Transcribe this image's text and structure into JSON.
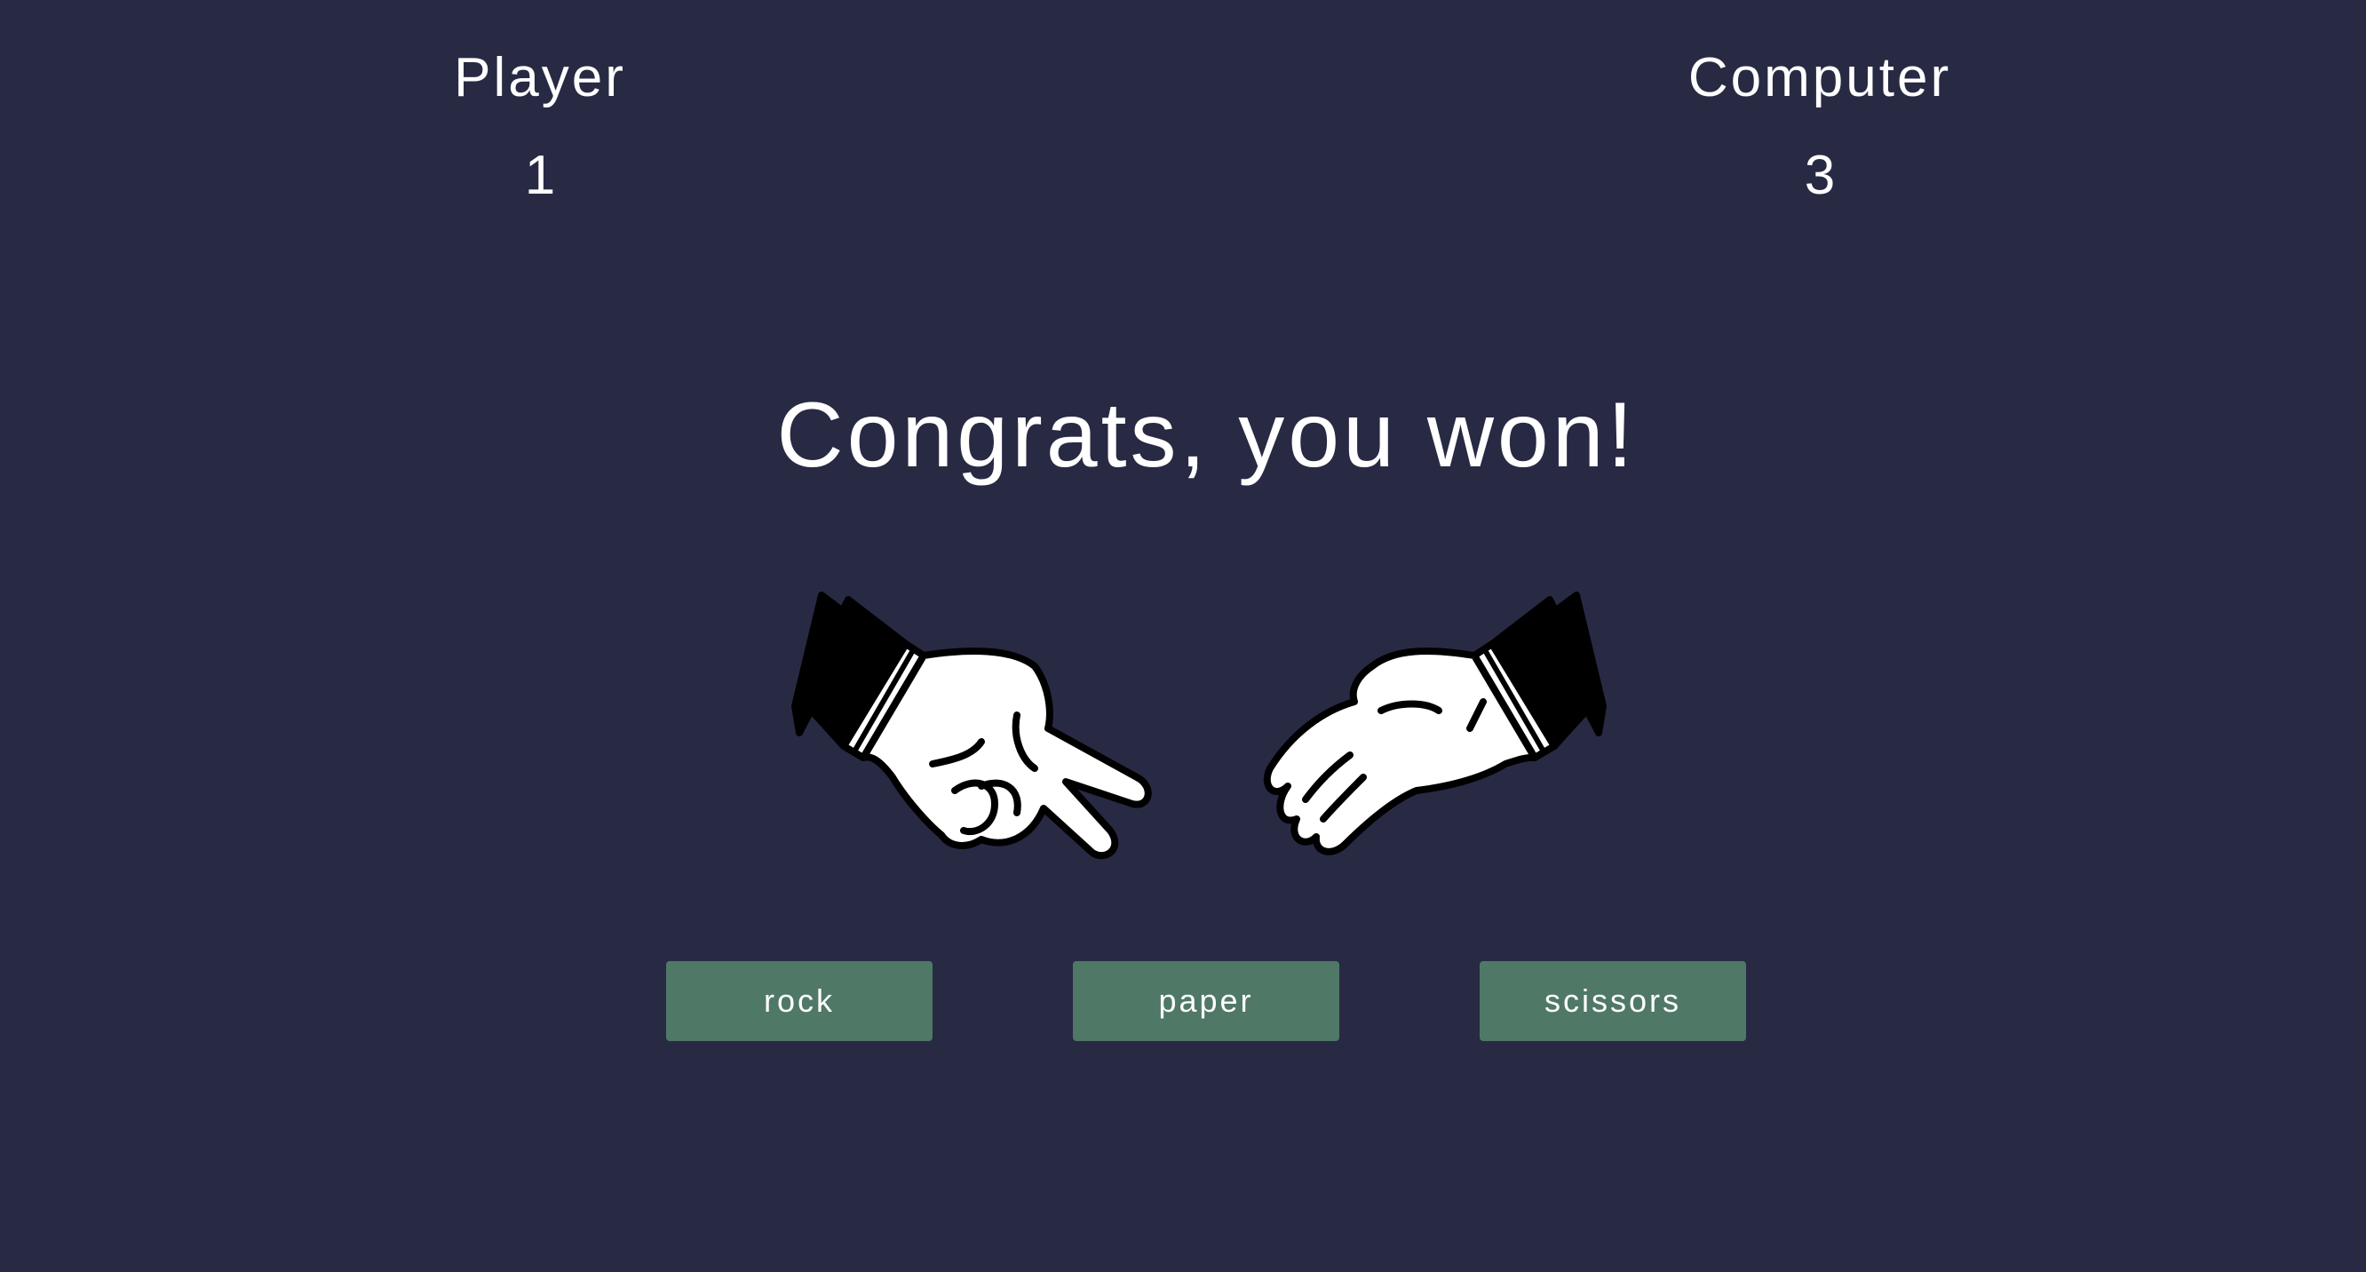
{
  "scoreboard": {
    "player": {
      "label": "Player",
      "score": "1"
    },
    "computer": {
      "label": "Computer",
      "score": "3"
    }
  },
  "result": {
    "message": "Congrats, you won!"
  },
  "hands": {
    "player_choice_icon": "scissors-hand-icon",
    "computer_choice_icon": "paper-hand-icon"
  },
  "choices": {
    "rock": "rock",
    "paper": "paper",
    "scissors": "scissors"
  },
  "colors": {
    "background": "#282a44",
    "button": "#4f7867",
    "text": "#ffffff"
  }
}
